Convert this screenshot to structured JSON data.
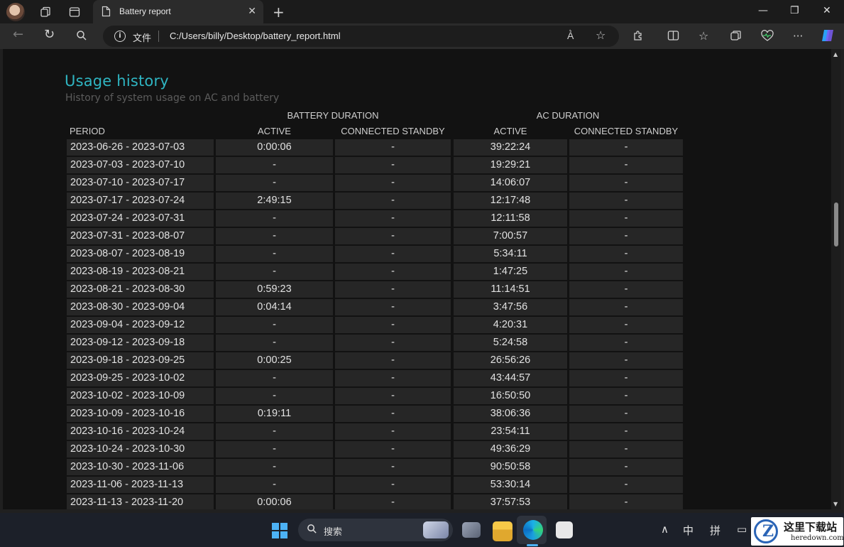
{
  "browser": {
    "tab_title": "Battery report",
    "address_label": "文件",
    "url": "C:/Users/billy/Desktop/battery_report.html"
  },
  "report": {
    "title": "Usage history",
    "subtitle": "History of system usage on AC and battery",
    "group_headers": [
      "BATTERY DURATION",
      "AC DURATION"
    ],
    "columns": [
      "PERIOD",
      "ACTIVE",
      "CONNECTED STANDBY",
      "ACTIVE",
      "CONNECTED STANDBY"
    ],
    "rows": [
      [
        "2023-06-26 - 2023-07-03",
        "0:00:06",
        "-",
        "39:22:24",
        "-"
      ],
      [
        "2023-07-03 - 2023-07-10",
        "-",
        "-",
        "19:29:21",
        "-"
      ],
      [
        "2023-07-10 - 2023-07-17",
        "-",
        "-",
        "14:06:07",
        "-"
      ],
      [
        "2023-07-17 - 2023-07-24",
        "2:49:15",
        "-",
        "12:17:48",
        "-"
      ],
      [
        "2023-07-24 - 2023-07-31",
        "-",
        "-",
        "12:11:58",
        "-"
      ],
      [
        "2023-07-31 - 2023-08-07",
        "-",
        "-",
        "7:00:57",
        "-"
      ],
      [
        "2023-08-07 - 2023-08-19",
        "-",
        "-",
        "5:34:11",
        "-"
      ],
      [
        "2023-08-19 - 2023-08-21",
        "-",
        "-",
        "1:47:25",
        "-"
      ],
      [
        "2023-08-21 - 2023-08-30",
        "0:59:23",
        "-",
        "11:14:51",
        "-"
      ],
      [
        "2023-08-30 - 2023-09-04",
        "0:04:14",
        "-",
        "3:47:56",
        "-"
      ],
      [
        "2023-09-04 - 2023-09-12",
        "-",
        "-",
        "4:20:31",
        "-"
      ],
      [
        "2023-09-12 - 2023-09-18",
        "-",
        "-",
        "5:24:58",
        "-"
      ],
      [
        "2023-09-18 - 2023-09-25",
        "0:00:25",
        "-",
        "26:56:26",
        "-"
      ],
      [
        "2023-09-25 - 2023-10-02",
        "-",
        "-",
        "43:44:57",
        "-"
      ],
      [
        "2023-10-02 - 2023-10-09",
        "-",
        "-",
        "16:50:50",
        "-"
      ],
      [
        "2023-10-09 - 2023-10-16",
        "0:19:11",
        "-",
        "38:06:36",
        "-"
      ],
      [
        "2023-10-16 - 2023-10-24",
        "-",
        "-",
        "23:54:11",
        "-"
      ],
      [
        "2023-10-24 - 2023-10-30",
        "-",
        "-",
        "49:36:29",
        "-"
      ],
      [
        "2023-10-30 - 2023-11-06",
        "-",
        "-",
        "90:50:58",
        "-"
      ],
      [
        "2023-11-06 - 2023-11-13",
        "-",
        "-",
        "53:30:14",
        "-"
      ],
      [
        "2023-11-13 - 2023-11-20",
        "0:00:06",
        "-",
        "37:57:53",
        "-"
      ]
    ]
  },
  "taskbar": {
    "search_placeholder": "搜索",
    "tray_ime_1": "中",
    "tray_ime_2": "拼"
  },
  "watermark": {
    "name": "这里下载站",
    "domain": "heredown.com"
  }
}
